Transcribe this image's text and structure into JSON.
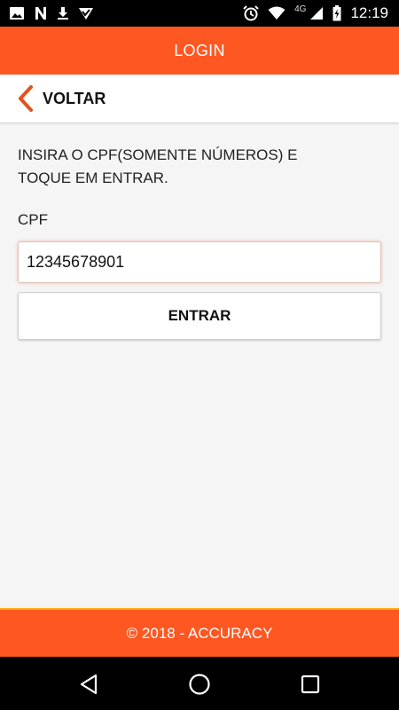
{
  "status_bar": {
    "time": "12:19",
    "network": "4G",
    "icons": [
      "image-icon",
      "n-notification-icon",
      "download-icon",
      "checkmark-app-icon",
      "alarm-icon",
      "wifi-icon",
      "signal-icon",
      "battery-charging-icon"
    ]
  },
  "header": {
    "title": "LOGIN"
  },
  "back_bar": {
    "label": "VOLTAR",
    "icon": "chevron-left-icon"
  },
  "form": {
    "instructions_line1": "INSIRA O CPF(SOMENTE NÚMEROS) E",
    "instructions_line2": "TOQUE EM ENTRAR.",
    "cpf_label": "CPF",
    "cpf_value": "12345678901",
    "submit_label": "ENTRAR"
  },
  "footer": {
    "text": "© 2018 - ACCURACY"
  },
  "nav_bar": {
    "icons": [
      "back-triangle-icon",
      "home-circle-icon",
      "recents-square-icon"
    ]
  },
  "colors": {
    "accent": "#ff5722",
    "footer_border": "#ffb01f",
    "back_chevron": "#e0531e"
  }
}
